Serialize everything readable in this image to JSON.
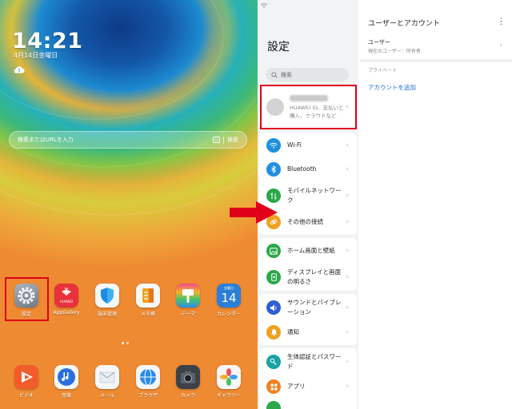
{
  "home": {
    "clock": "14:21",
    "date": "4月14日金曜日",
    "search_placeholder": "検索またはURLを入力",
    "search_button": "検索",
    "apps_row1": [
      {
        "label": "設定",
        "icon": "gear-icon"
      },
      {
        "label": "AppGallery",
        "icon": "appgallery-icon"
      },
      {
        "label": "端末管理",
        "icon": "shield-icon"
      },
      {
        "label": "メモ帳",
        "icon": "notepad-icon"
      },
      {
        "label": "テーマ",
        "icon": "brush-icon"
      },
      {
        "label": "カレンダー",
        "icon": "calendar-icon",
        "day": "14",
        "weekday": "金曜日"
      }
    ],
    "apps_dock": [
      {
        "label": "ビデオ",
        "icon": "video-icon"
      },
      {
        "label": "音楽",
        "icon": "music-icon"
      },
      {
        "label": "メール",
        "icon": "mail-icon"
      },
      {
        "label": "ブラウザ",
        "icon": "browser-icon"
      },
      {
        "label": "カメラ",
        "icon": "camera-icon"
      },
      {
        "label": "ギャラリー",
        "icon": "gallery-icon"
      }
    ],
    "appgallery_logo_text": "HUAWEI"
  },
  "settings": {
    "title": "設定",
    "search_placeholder": "検索",
    "account_sub": "HUAWEI ID、支払いと購入、クラウドなど",
    "items": [
      {
        "label": "Wi-Fi",
        "icon": "wifi-icon",
        "color": "#1f8fe0"
      },
      {
        "label": "Bluetooth",
        "icon": "bluetooth-icon",
        "color": "#1f8fe0"
      },
      {
        "label": "モバイルネットワーク",
        "icon": "mobile-network-icon",
        "color": "#2aa84a"
      },
      {
        "label": "その他の接続",
        "icon": "link-icon",
        "color": "#f0a020"
      },
      {
        "label": "ホーム画面と壁紙",
        "icon": "wallpaper-icon",
        "color": "#2aa84a"
      },
      {
        "label": "ディスプレイと画面の明るさ",
        "icon": "display-icon",
        "color": "#2aa84a"
      },
      {
        "label": "サウンドとバイブレーション",
        "icon": "sound-icon",
        "color": "#2f5fd0"
      },
      {
        "label": "通知",
        "icon": "bell-icon",
        "color": "#f0a020"
      },
      {
        "label": "生体認証とパスワード",
        "icon": "key-icon",
        "color": "#15a3a3"
      },
      {
        "label": "アプリ",
        "icon": "apps-icon",
        "color": "#f08020"
      }
    ],
    "detail": {
      "title": "ユーザーとアカウント",
      "user_label": "ユーザー",
      "user_sub": "現在のユーザー：所有者",
      "private_label": "プライベート",
      "add_account": "アカウントを追加"
    }
  },
  "colors": {
    "highlight": "#e0001a",
    "link": "#1a6cd4",
    "arrow": "#e0001a"
  }
}
